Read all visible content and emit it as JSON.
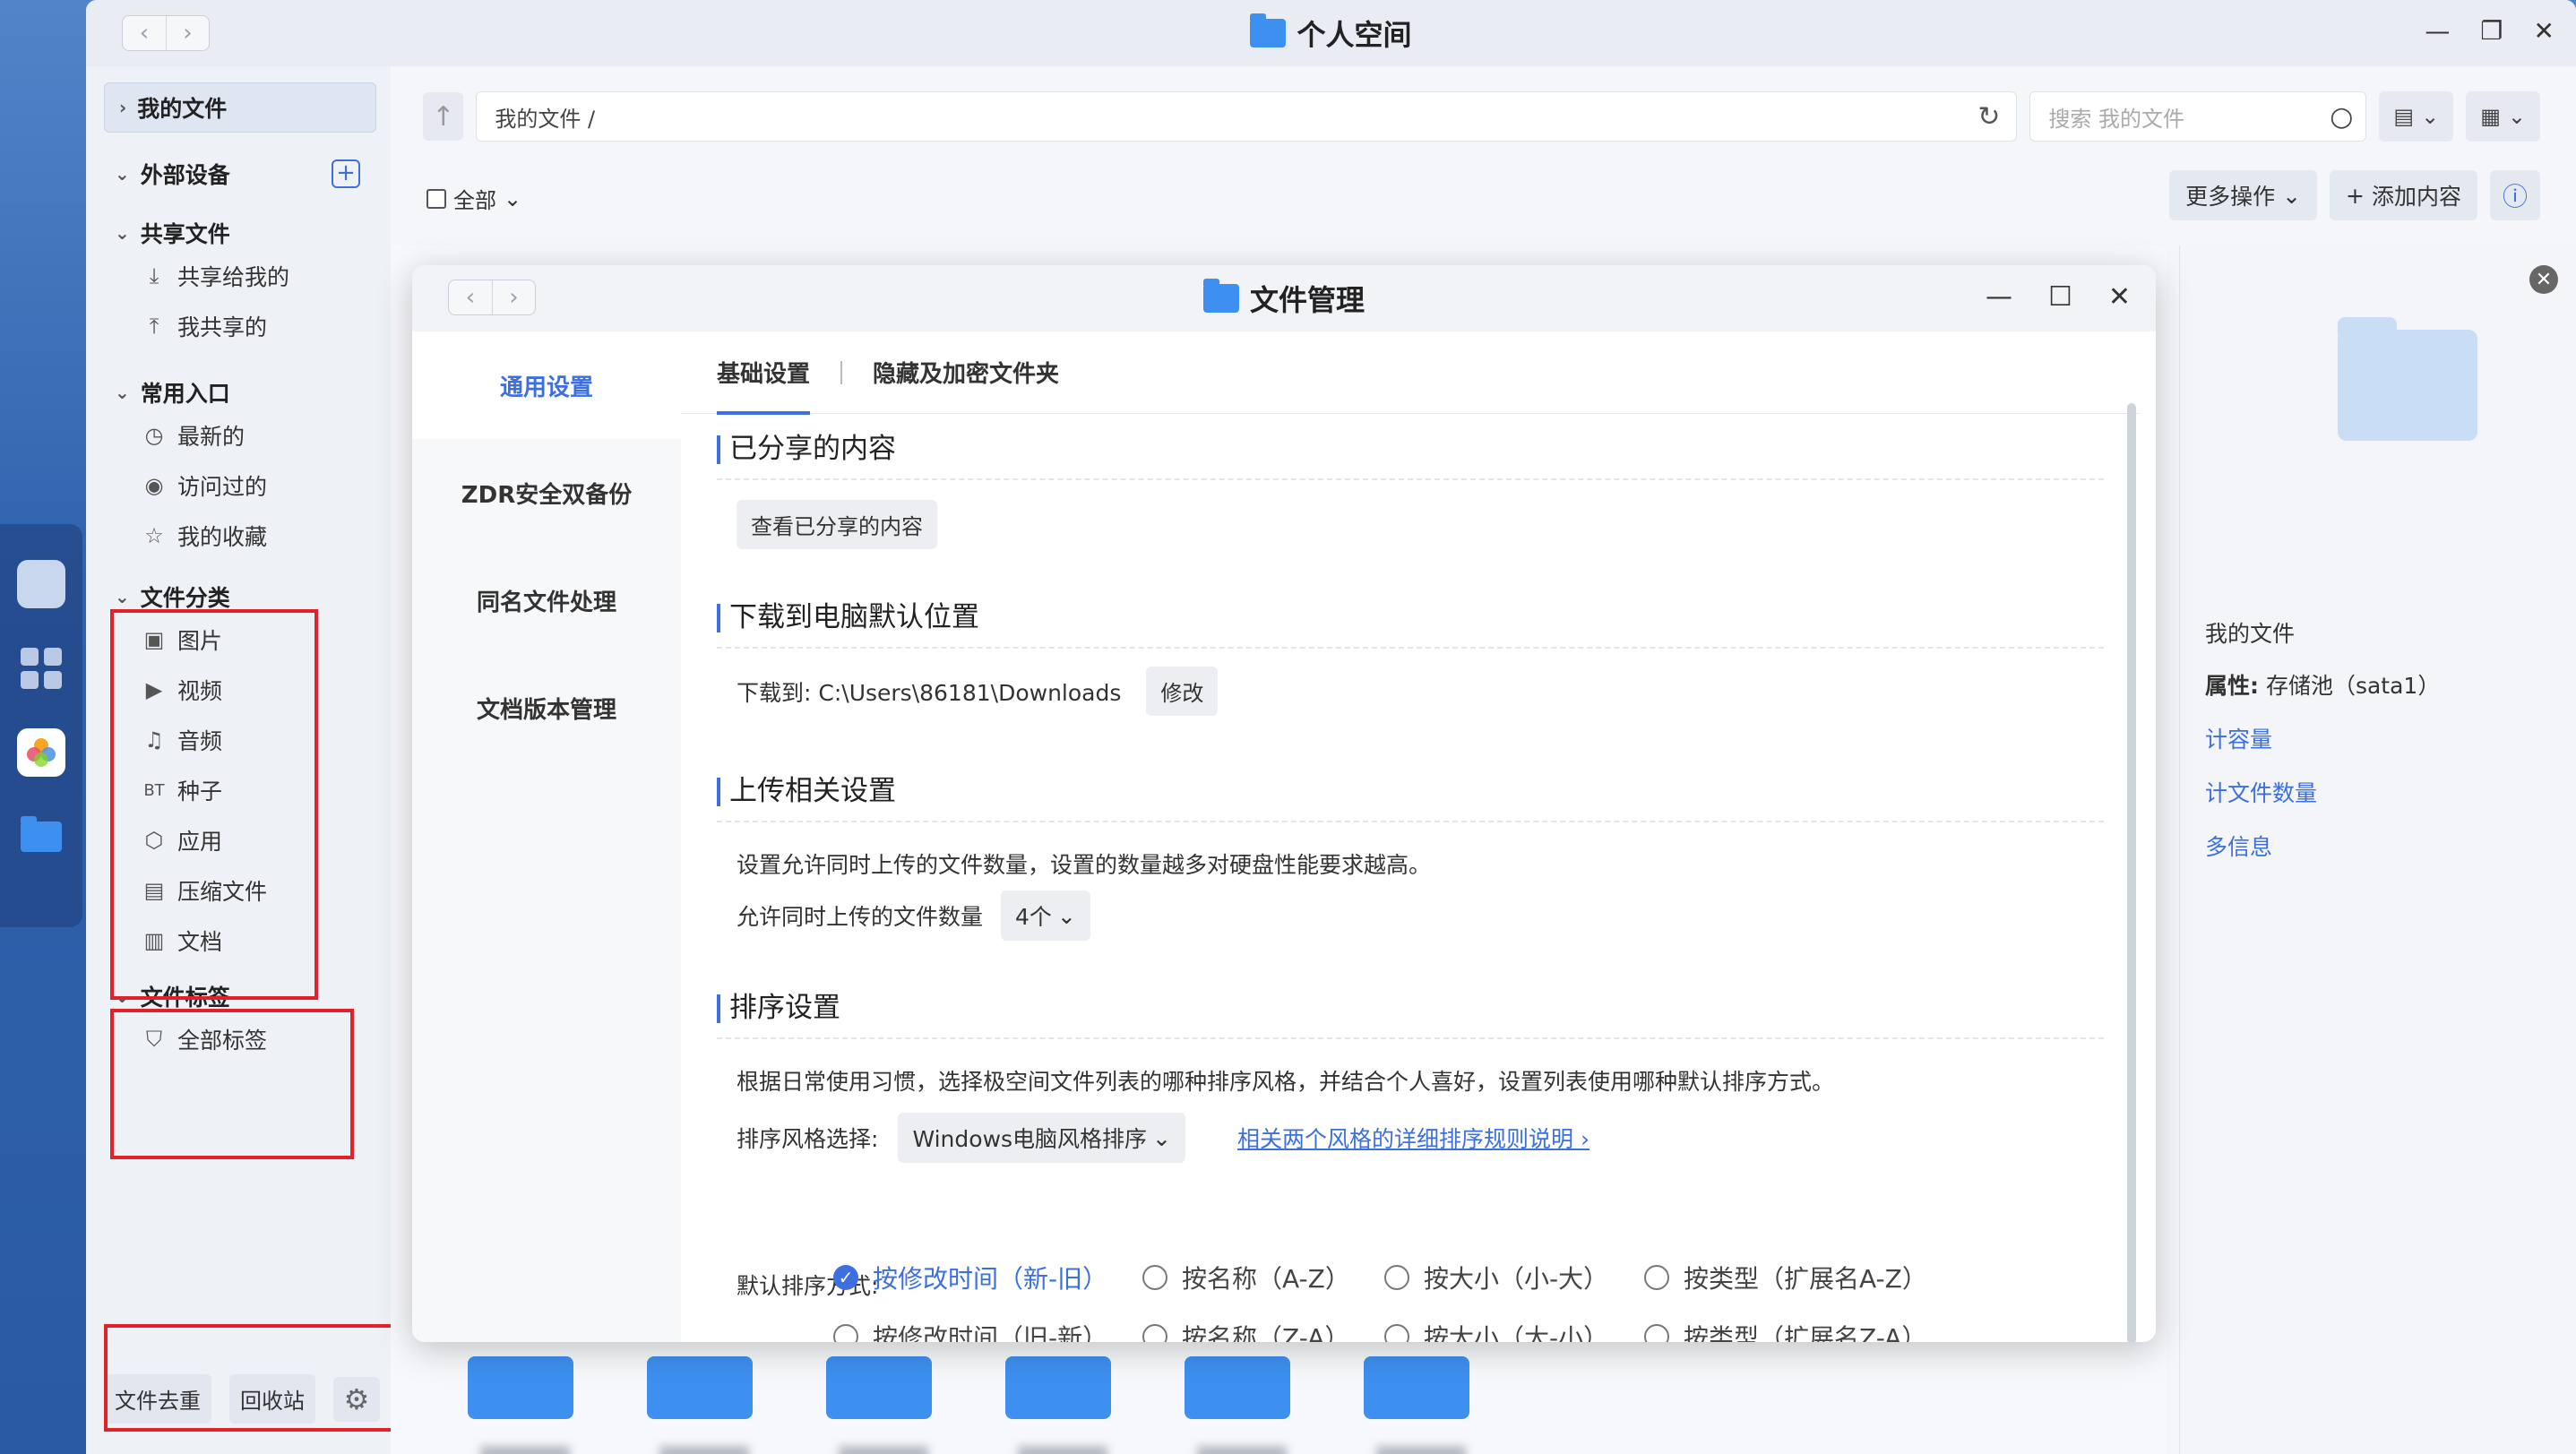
{
  "window": {
    "title": "个人空间"
  },
  "sidebar": {
    "my_files": "我的文件",
    "external": "外部设备",
    "shared_head": "共享文件",
    "shared_items": [
      "共享给我的",
      "我共享的"
    ],
    "common_head": "常用入口",
    "common_items": [
      "最新的",
      "访问过的",
      "我的收藏"
    ],
    "category_head": "文件分类",
    "category_items": [
      {
        "icon": "image-icon",
        "glyph": "▣",
        "label": "图片"
      },
      {
        "icon": "video-icon",
        "glyph": "▶",
        "label": "视频"
      },
      {
        "icon": "music-icon",
        "glyph": "♫",
        "label": "音频"
      },
      {
        "icon": "bt-icon",
        "glyph": "BT",
        "label": "种子"
      },
      {
        "icon": "app-icon",
        "glyph": "⬡",
        "label": "应用"
      },
      {
        "icon": "archive-icon",
        "glyph": "▤",
        "label": "压缩文件"
      },
      {
        "icon": "document-icon",
        "glyph": "▥",
        "label": "文档"
      }
    ],
    "tags_head": "文件标签",
    "tags_items": [
      "全部标签"
    ],
    "dedupe": "文件去重",
    "recycle": "回收站"
  },
  "toolbar": {
    "path": "我的文件 /",
    "search_placeholder": "搜索 我的文件",
    "select_all": "全部",
    "more_actions": "更多操作",
    "add_content": "添加内容"
  },
  "info_pane": {
    "location": "我的文件",
    "property_label": "属性:",
    "property_value": "存储池（sata1）",
    "calc_capacity": "计容量",
    "calc_count": "计文件数量",
    "more_info": "多信息"
  },
  "modal": {
    "title": "文件管理",
    "nav": [
      "通用设置",
      "ZDR安全双备份",
      "同名文件处理",
      "文档版本管理"
    ],
    "tabs": [
      "基础设置",
      "隐藏及加密文件夹"
    ],
    "shared_section": {
      "title": "已分享的内容",
      "button": "查看已分享的内容"
    },
    "download_section": {
      "title": "下载到电脑默认位置",
      "label": "下载到:",
      "path": "C:\\Users\\86181\\Downloads",
      "button": "修改"
    },
    "upload_section": {
      "title": "上传相关设置",
      "desc": "设置允许同时上传的文件数量，设置的数量越多对硬盘性能要求越高。",
      "count_label": "允许同时上传的文件数量",
      "count_value": "4个"
    },
    "sort_section": {
      "title": "排序设置",
      "desc": "根据日常使用习惯，选择极空间文件列表的哪种排序风格，并结合个人喜好，设置列表使用哪种默认排序方式。",
      "style_label": "排序风格选择:",
      "style_value": "Windows电脑风格排序",
      "rules_link": "相关两个风格的详细排序规则说明",
      "default_label": "默认排序方式:",
      "options": [
        "按修改时间（新-旧）",
        "按名称（A-Z）",
        "按大小（小-大）",
        "按类型（扩展名A-Z）",
        "按修改时间（旧-新）",
        "按名称（Z-A）",
        "按大小（大-小）",
        "按类型（扩展名Z-A）"
      ],
      "selected_index": 0
    }
  },
  "colors": {
    "accent": "#3c6fe0",
    "highlight": "#e2222a",
    "folder": "#3d8ff0"
  }
}
